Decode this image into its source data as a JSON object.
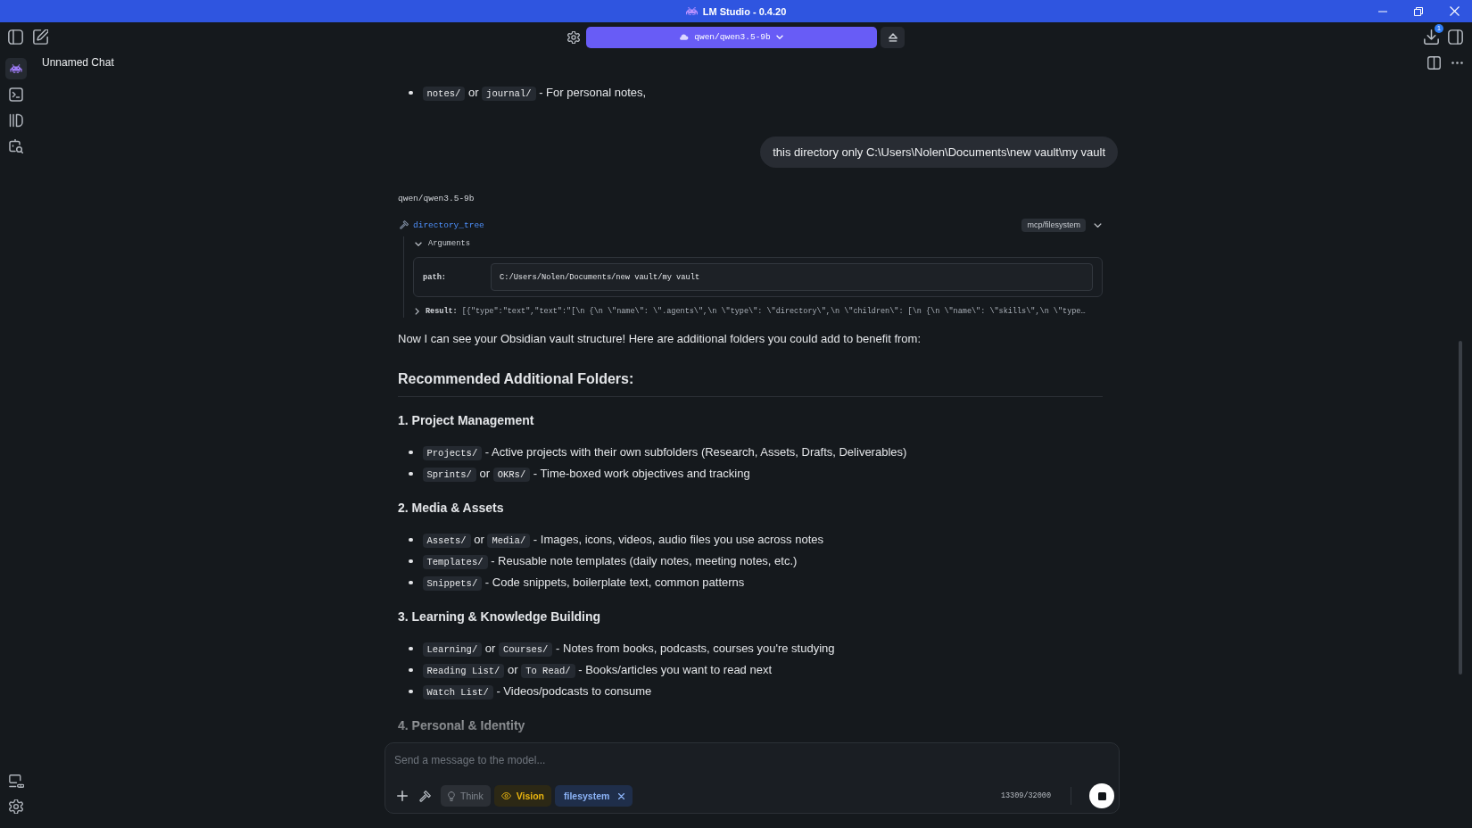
{
  "window": {
    "title": "LM Studio - 0.4.20"
  },
  "toolbar": {
    "model": "qwen/qwen3.5-9b",
    "download_badge": "1"
  },
  "sidebar": {
    "items": [
      {
        "kind": "chat",
        "selected": true
      },
      {
        "kind": "terminal",
        "selected": false
      },
      {
        "kind": "models",
        "selected": false
      },
      {
        "kind": "discover",
        "selected": false
      }
    ]
  },
  "chat": {
    "title": "Unnamed Chat",
    "messages": [
      {
        "kind": "assistant",
        "blocks": [
          {
            "kind": "bullets",
            "items": [
              [
                {
                  "kind": "code",
                  "text": "notes/"
                },
                {
                  "kind": "text",
                  "text": " or "
                },
                {
                  "kind": "code",
                  "text": "journal/"
                },
                {
                  "kind": "text",
                  "text": " - For personal notes,"
                }
              ]
            ]
          }
        ]
      },
      {
        "kind": "user",
        "text": "this directory only C:\\Users\\Nolen\\Documents\\new vault\\my vault"
      },
      {
        "kind": "assistant",
        "model": "qwen/qwen3.5-9b",
        "tool_call": {
          "name": "directory_tree",
          "server": "mcp/filesystem",
          "expanded": true,
          "arguments": {
            "label": "Arguments",
            "expanded": true,
            "fields": [
              {
                "key": "path:",
                "value": "C:/Users/Nolen/Documents/new vault/my vault"
              }
            ]
          },
          "result": {
            "label": "Result:",
            "expanded": false,
            "text": "[{\"type\":\"text\",\"text\":\"[\\n {\\n \\\"name\\\": \\\".agents\\\",\\n \\\"type\\\": \\\"directory\\\",\\n \\\"children\\\": [\\n {\\n \\\"name\\\": \\\"skills\\\",\\n \\\"type…"
          }
        },
        "blocks": [
          {
            "kind": "paragraph",
            "text": "Now I can see your Obsidian vault structure! Here are additional folders you could add to benefit from:"
          },
          {
            "kind": "heading",
            "text": "Recommended Additional Folders:"
          },
          {
            "kind": "subheading",
            "text": "1. Project Management"
          },
          {
            "kind": "bullets",
            "items": [
              [
                {
                  "kind": "code",
                  "text": "Projects/"
                },
                {
                  "kind": "text",
                  "text": " - Active projects with their own subfolders (Research, Assets, Drafts, Deliverables)"
                }
              ],
              [
                {
                  "kind": "code",
                  "text": "Sprints/"
                },
                {
                  "kind": "text",
                  "text": " or "
                },
                {
                  "kind": "code",
                  "text": "OKRs/"
                },
                {
                  "kind": "text",
                  "text": " - Time-boxed work objectives and tracking"
                }
              ]
            ]
          },
          {
            "kind": "subheading",
            "text": "2. Media & Assets"
          },
          {
            "kind": "bullets",
            "items": [
              [
                {
                  "kind": "code",
                  "text": "Assets/"
                },
                {
                  "kind": "text",
                  "text": " or "
                },
                {
                  "kind": "code",
                  "text": "Media/"
                },
                {
                  "kind": "text",
                  "text": " - Images, icons, videos, audio files you use across notes"
                }
              ],
              [
                {
                  "kind": "code",
                  "text": "Templates/"
                },
                {
                  "kind": "text",
                  "text": " - Reusable note templates (daily notes, meeting notes, etc.)"
                }
              ],
              [
                {
                  "kind": "code",
                  "text": "Snippets/"
                },
                {
                  "kind": "text",
                  "text": " - Code snippets, boilerplate text, common patterns"
                }
              ]
            ]
          },
          {
            "kind": "subheading",
            "text": "3. Learning & Knowledge Building"
          },
          {
            "kind": "bullets",
            "items": [
              [
                {
                  "kind": "code",
                  "text": "Learning/"
                },
                {
                  "kind": "text",
                  "text": " or "
                },
                {
                  "kind": "code",
                  "text": "Courses/"
                },
                {
                  "kind": "text",
                  "text": " - Notes from books, podcasts, courses you're studying"
                }
              ],
              [
                {
                  "kind": "code",
                  "text": "Reading List/"
                },
                {
                  "kind": "text",
                  "text": " or "
                },
                {
                  "kind": "code",
                  "text": "To Read/"
                },
                {
                  "kind": "text",
                  "text": " - Books/articles you want to read next"
                }
              ],
              [
                {
                  "kind": "code",
                  "text": "Watch List/"
                },
                {
                  "kind": "text",
                  "text": " - Videos/podcasts to consume"
                }
              ]
            ]
          },
          {
            "kind": "subheading",
            "text": "4. Personal & Identity"
          }
        ]
      }
    ]
  },
  "composer": {
    "placeholder": "Send a message to the model...",
    "toggles": [
      {
        "kind": "think",
        "label": "Think",
        "on": false
      },
      {
        "kind": "vision",
        "label": "Vision",
        "on": true
      }
    ],
    "tools": [
      {
        "label": "filesystem"
      }
    ],
    "token_count": "13309/32000",
    "generating": true
  }
}
